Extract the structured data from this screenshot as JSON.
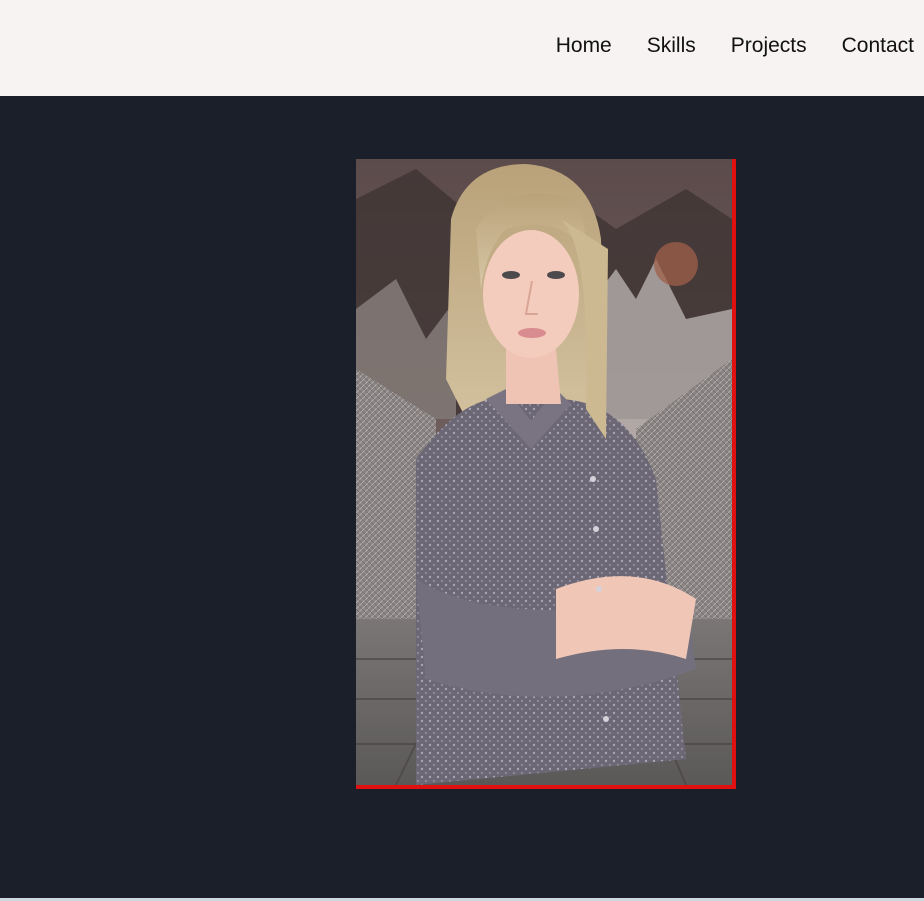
{
  "nav": {
    "items": [
      {
        "label": "Home"
      },
      {
        "label": "Skills"
      },
      {
        "label": "Projects"
      },
      {
        "label": "Contact"
      }
    ]
  },
  "hero": {
    "portrait_alt": "Portrait photo of a woman with crossed arms standing on a suspension bridge",
    "frame_color": "#e01010",
    "background_color": "#1b1f2a",
    "header_color": "#f6f3f2"
  }
}
